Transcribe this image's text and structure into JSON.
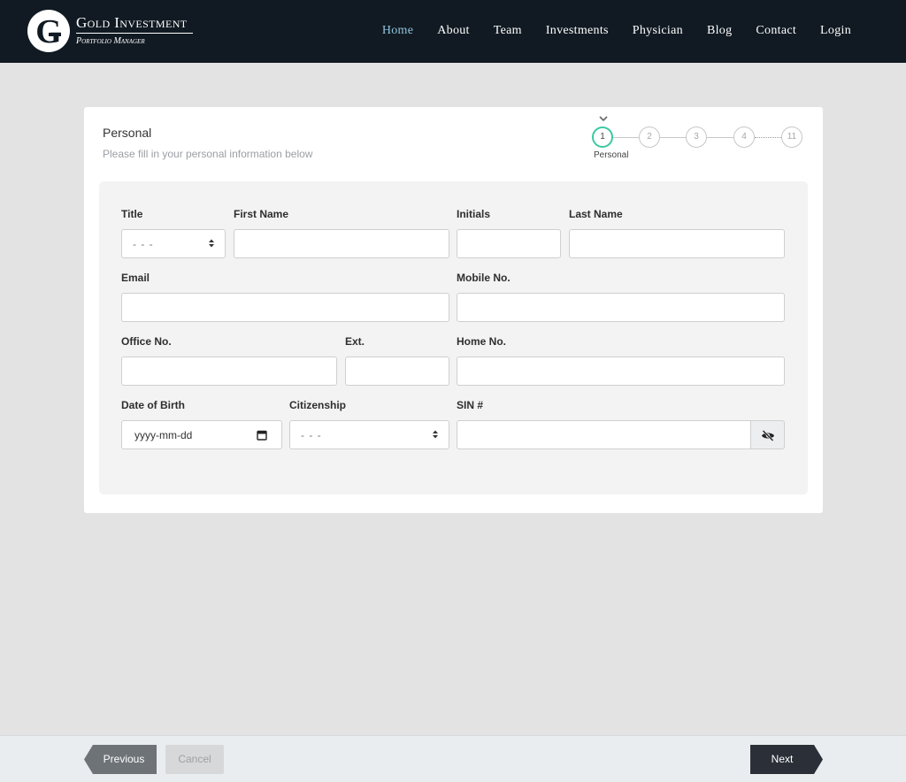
{
  "brand": {
    "title": "Gold Investment",
    "subtitle": "Portfolio Manager"
  },
  "nav": {
    "items": [
      {
        "label": "Home",
        "active": true
      },
      {
        "label": "About"
      },
      {
        "label": "Team"
      },
      {
        "label": "Investments"
      },
      {
        "label": "Physician"
      },
      {
        "label": "Blog"
      },
      {
        "label": "Contact"
      },
      {
        "label": "Login"
      }
    ],
    "active_color": "#8fc3dc"
  },
  "form": {
    "title": "Personal",
    "subtitle": "Please fill in your personal information below",
    "steps": [
      "1",
      "2",
      "3",
      "4",
      "11"
    ],
    "current_step_label": "Personal",
    "fields": {
      "title": {
        "label": "Title",
        "value": "- - -"
      },
      "first_name": {
        "label": "First Name",
        "value": ""
      },
      "initials": {
        "label": "Initials",
        "value": ""
      },
      "last_name": {
        "label": "Last Name",
        "value": ""
      },
      "email": {
        "label": "Email",
        "value": ""
      },
      "mobile": {
        "label": "Mobile No.",
        "value": ""
      },
      "office": {
        "label": "Office No.",
        "value": ""
      },
      "ext": {
        "label": "Ext.",
        "value": ""
      },
      "home": {
        "label": "Home No.",
        "value": ""
      },
      "dob": {
        "label": "Date of Birth",
        "value": "yyyy-mm-dd"
      },
      "citizenship": {
        "label": "Citizenship",
        "value": "- - -"
      },
      "sin": {
        "label": "SIN #",
        "value": ""
      }
    }
  },
  "footer": {
    "previous": "Previous",
    "cancel": "Cancel",
    "next": "Next"
  },
  "colors": {
    "header_bg": "#111a22",
    "step_active": "#3cc8a3",
    "next_button": "#2b3038",
    "prev_button": "#6e7378"
  },
  "icons": [
    "gold-logo-icon",
    "chevron-down-icon",
    "select-caret-icon",
    "calendar-icon",
    "eye-slash-icon"
  ]
}
